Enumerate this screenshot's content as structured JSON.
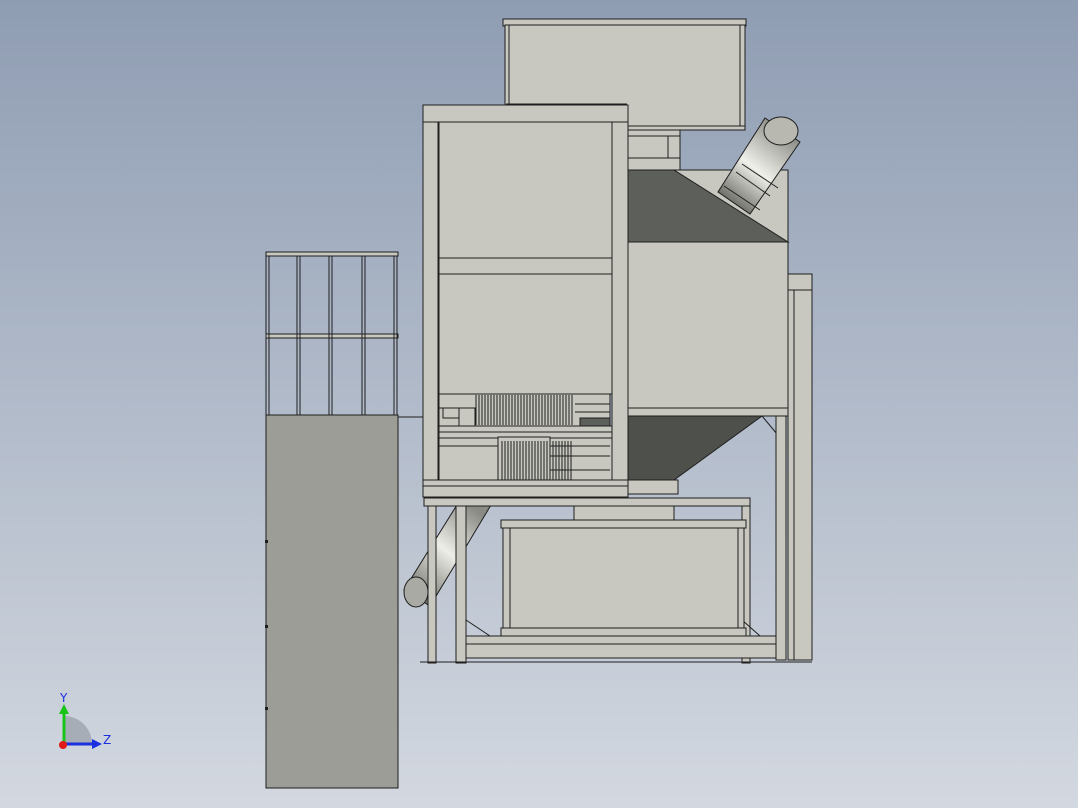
{
  "viewport": {
    "background_top": "#8f9db3",
    "background_bottom": "#d3d8e0",
    "part_fill_light": "#c8c8c0",
    "part_fill_mid": "#a9aaa3",
    "part_fill_dark": "#5d5f5b",
    "part_fill_panel": "#9c9d97",
    "edge_color": "#1e1e1e",
    "pipe_highlight": "#f0f0ea",
    "pipe_shadow": "#6f706a"
  },
  "triad": {
    "y_label": "Y",
    "z_label": "Z",
    "y_color": "#19c419",
    "z_color": "#1c2fe0",
    "x_color": "#e01919"
  }
}
